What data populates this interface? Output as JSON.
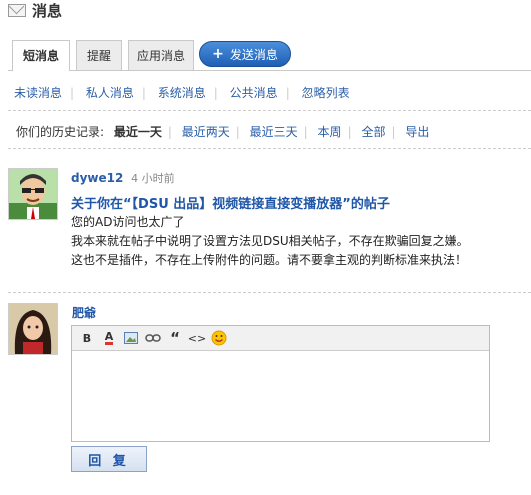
{
  "header": {
    "title": "消息"
  },
  "tabs": [
    {
      "label": "短消息",
      "active": true
    },
    {
      "label": "提醒",
      "active": false
    },
    {
      "label": "应用消息",
      "active": false
    }
  ],
  "send_button": {
    "label": "发送消息"
  },
  "filters": [
    "未读消息",
    "私人消息",
    "系统消息",
    "公共消息",
    "忽略列表"
  ],
  "history": {
    "label": "你们的历史记录:",
    "options": [
      "最近一天",
      "最近两天",
      "最近三天",
      "本周",
      "全部",
      "导出"
    ],
    "current": "最近一天"
  },
  "message": {
    "author": "dywe12",
    "time": "4 小时前",
    "subject": "关于你在“【DSU 出品】视频链接直接变播放器”的帖子",
    "body": [
      "您的AD访问也太广了",
      "我本来就在帖子中说明了设置方法见DSU相关帖子，不存在欺骗回复之嫌。",
      "这也不是插件，不存在上传附件的问题。请不要拿主观的判断标准来执法！"
    ]
  },
  "reply": {
    "username": "肥爺",
    "button_label": "回 复",
    "toolbar": [
      "bold-icon",
      "font-color-icon",
      "image-icon",
      "link-icon",
      "quote-icon",
      "code-icon",
      "smiley-icon"
    ]
  },
  "colors": {
    "link": "#2b5ea8",
    "send_button": "#2f72c4"
  }
}
